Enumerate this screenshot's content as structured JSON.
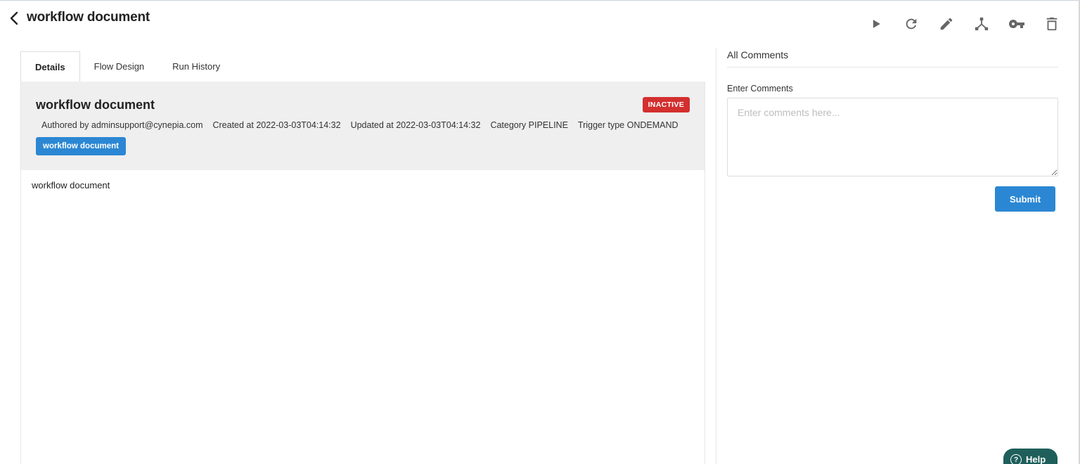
{
  "header": {
    "title": "workflow document",
    "back_icon": "chevron-left-icon",
    "toolbar": [
      {
        "name": "run-button",
        "icon": "play-icon"
      },
      {
        "name": "refresh-button",
        "icon": "refresh-icon"
      },
      {
        "name": "edit-button",
        "icon": "pencil-icon"
      },
      {
        "name": "fork-button",
        "icon": "fork-icon"
      },
      {
        "name": "key-button",
        "icon": "key-icon"
      },
      {
        "name": "delete-button",
        "icon": "trash-icon"
      }
    ]
  },
  "tabs": [
    {
      "label": "Details",
      "active": true
    },
    {
      "label": "Flow Design",
      "active": false
    },
    {
      "label": "Run History",
      "active": false
    }
  ],
  "details": {
    "title": "workflow document",
    "status": "INACTIVE",
    "status_color": "#d32f2f",
    "meta": {
      "author": "Authored by adminsupport@cynepia.com",
      "created": "Created at 2022-03-03T04:14:32",
      "updated": "Updated at 2022-03-03T04:14:32",
      "category": "Category PIPELINE",
      "trigger": "Trigger type ONDEMAND"
    },
    "tag": "workflow document",
    "body": "workflow document"
  },
  "comments": {
    "title": "All Comments",
    "input_label": "Enter Comments",
    "input_value": "",
    "placeholder": "Enter comments here...",
    "submit_label": "Submit"
  },
  "help": {
    "label": "Help",
    "icon": "question-circle-icon"
  },
  "colors": {
    "accent": "#2b87d3",
    "help_bg": "#1f5f5b",
    "panel_bg": "#efefef"
  }
}
